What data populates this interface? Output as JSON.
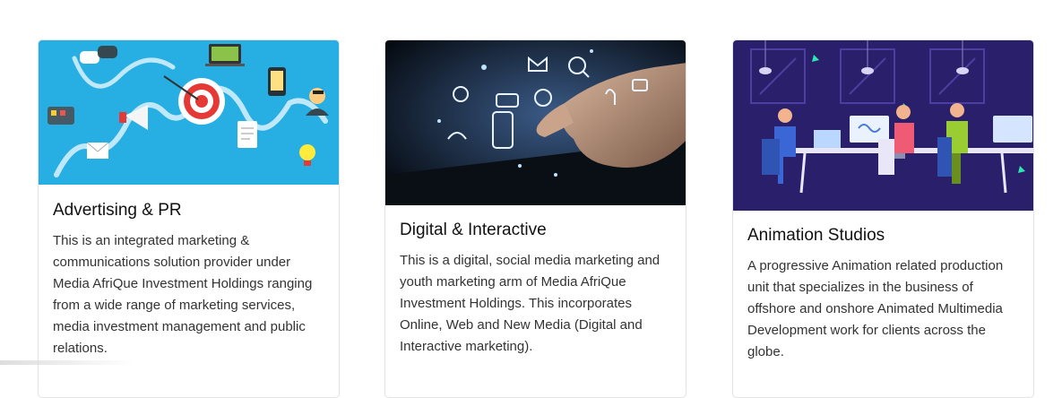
{
  "cards": [
    {
      "title": "Advertising & PR",
      "description": "This is an integrated marketing & communications solution provider under Media AfriQue Investment Holdings ranging from a wide range of marketing services, media investment management and public relations.",
      "image_icon": "marketing-illustration"
    },
    {
      "title": "Digital & Interactive",
      "description": "This is a digital, social media marketing and youth marketing arm of Media AfriQue Investment Holdings. This incorporates Online, Web and New Media (Digital and Interactive marketing).",
      "image_icon": "touchscreen-photo"
    },
    {
      "title": "Animation Studios",
      "description": "A progressive Animation related production unit that specializes in the business of offshore and onshore Animated Multimedia Development work for clients across the globe.",
      "image_icon": "animation-studio-illustration"
    }
  ],
  "colors": {
    "card1_bg": "#27aee3",
    "card2_bg": "#0e1826",
    "card3_bg": "#2a1f6b"
  }
}
